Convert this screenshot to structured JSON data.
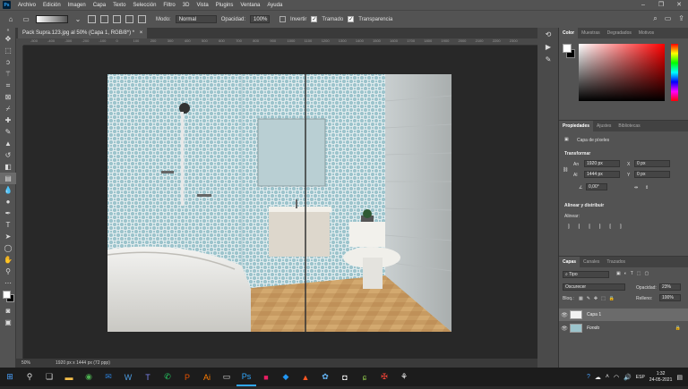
{
  "menu": [
    "Archivo",
    "Edición",
    "Imagen",
    "Capa",
    "Texto",
    "Selección",
    "Filtro",
    "3D",
    "Vista",
    "Plugins",
    "Ventana",
    "Ayuda"
  ],
  "logo": "Ps",
  "options": {
    "mode_label": "Modo:",
    "mode_value": "Normal",
    "opacity_label": "Opacidad:",
    "opacity_value": "100%",
    "invert_label": "Invertir",
    "dither_label": "Tramado",
    "transparency_label": "Transparencia"
  },
  "document": {
    "tab_title": "Pack Supra.123.jpg al 50% (Capa 1, RGB/8*) *",
    "close": "×"
  },
  "ruler_ticks": [
    "-500",
    "-400",
    "-300",
    "-200",
    "-100",
    "0",
    "100",
    "200",
    "300",
    "400",
    "500",
    "600",
    "700",
    "800",
    "900",
    "1000",
    "1100",
    "1200",
    "1300",
    "1400",
    "1500",
    "1600",
    "1700",
    "1800",
    "1900",
    "2000",
    "2100",
    "2200",
    "2300"
  ],
  "status": {
    "zoom": "50%",
    "doc_info": "1920 px x 1444 px (72 ppp)"
  },
  "color_panel": {
    "tabs": [
      "Color",
      "Muestras",
      "Degradados",
      "Motivos"
    ]
  },
  "properties": {
    "tabs": [
      "Propiedades",
      "Ajustes",
      "Bibliotecas"
    ],
    "pixel_layer": "Capa de píxeles",
    "transform": "Transformar",
    "an_label": "An",
    "an_value": "1920 px",
    "al_label": "Al",
    "al_value": "1444 px",
    "x_label": "X",
    "x_value": "0 px",
    "y_label": "Y",
    "y_value": "0 px",
    "angle_value": "0,00°",
    "align": "Alinear y distribuir",
    "align_sub": "Alinear:"
  },
  "layers": {
    "tabs": [
      "Capas",
      "Canales",
      "Trazados"
    ],
    "filter": "Tipo",
    "blend": "Oscurecer",
    "opacity_label": "Opacidad:",
    "opacity_value": "23%",
    "lock_label": "Bloq.:",
    "fill_label": "Relleno:",
    "fill_value": "100%",
    "items": [
      {
        "name": "Capa 1"
      },
      {
        "name": "Fondo"
      }
    ]
  },
  "taskbar": {
    "lang": "ESP",
    "time": "1:32",
    "date": "24-05-2021"
  },
  "colors": {
    "accent": "#31a8ff",
    "ui_dark": "#535353",
    "canvas_bg": "#282828"
  }
}
